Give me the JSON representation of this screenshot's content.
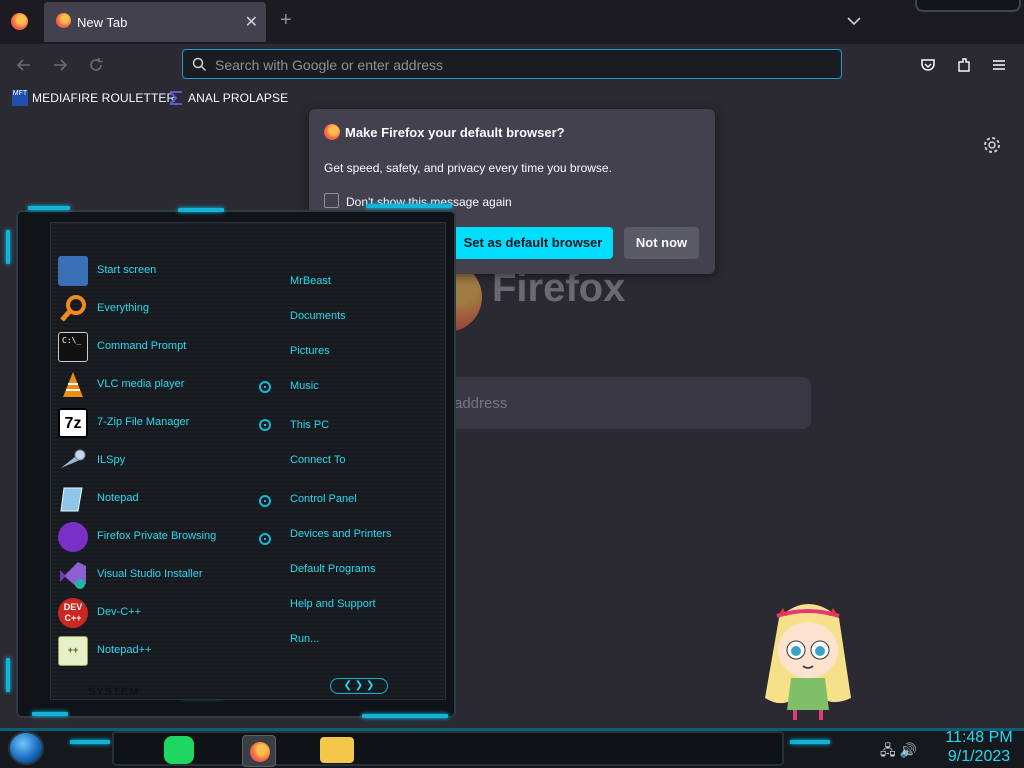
{
  "browser": {
    "tab_title": "New Tab",
    "tab_close": "✕",
    "new_tab": "+",
    "url_placeholder": "Search with Google or enter address",
    "bookmarks": [
      {
        "label": "MEDIAFIRE ROULETTER",
        "icon": "MFT"
      },
      {
        "label": "ANAL PROLAPSE"
      }
    ]
  },
  "newtab": {
    "brand": "Firefox",
    "search_placeholder": "address"
  },
  "popup": {
    "title": "Make Firefox your default browser?",
    "body": "Get speed, safety, and privacy every time you browse.",
    "checkbox_label": "Don't show this message again",
    "primary": "Set as default browser",
    "secondary": "Not now"
  },
  "start_menu": {
    "programs": [
      {
        "label": "Start screen",
        "icon": "start-screen-icon",
        "color": "#3a6fb8"
      },
      {
        "label": "Everything",
        "icon": "magnifier-icon",
        "color": "#f08a1c"
      },
      {
        "label": "Command Prompt",
        "icon": "cmd-icon",
        "color": "#111111"
      },
      {
        "label": "VLC media player",
        "icon": "vlc-cone-icon",
        "color": "#f28a16"
      },
      {
        "label": "7-Zip File Manager",
        "icon": "7zip-icon",
        "color": "#ffffff"
      },
      {
        "label": "ILSpy",
        "icon": "ilspy-icon",
        "color": "#9bb6cf"
      },
      {
        "label": "Notepad",
        "icon": "notepad-icon",
        "color": "#8fc6e8"
      },
      {
        "label": "Firefox Private Browsing",
        "icon": "private-browsing-icon",
        "color": "#7b2fc9"
      },
      {
        "label": "Visual Studio Installer",
        "icon": "vs-installer-icon",
        "color": "#8e5fd1"
      },
      {
        "label": "Dev-C++",
        "icon": "devcpp-icon",
        "color": "#c9271f"
      },
      {
        "label": "Notepad++",
        "icon": "notepadpp-icon",
        "color": "#e9f0c9"
      }
    ],
    "places": [
      "MrBeast",
      "Documents",
      "Pictures",
      "Music",
      "This PC",
      "Connect To",
      "Control Panel",
      "Devices and Printers",
      "Default Programs",
      "Help and Support",
      "Run..."
    ],
    "footer": "SYSTEM",
    "arrows": "❮ ❯ ❯"
  },
  "taskbar": {
    "time": "11:48 PM",
    "date": "9/1/2023"
  }
}
